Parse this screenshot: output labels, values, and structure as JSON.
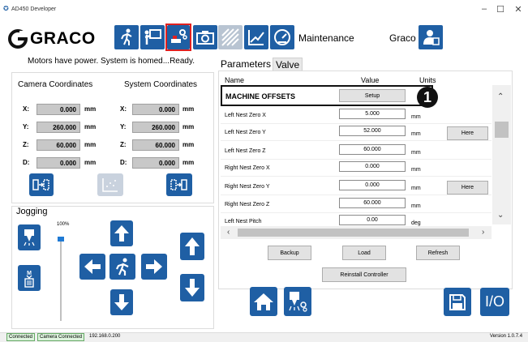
{
  "window": {
    "title": "AD450 Developer",
    "minimize": "–",
    "maximize": "☐",
    "close": "✕"
  },
  "brand": {
    "logo_text": "GRACO"
  },
  "toolbar": {
    "mode_label": "Maintenance",
    "user_name": "Graco"
  },
  "status_line": "Motors have power. System is homed...Ready.",
  "coordinates": {
    "camera_title": "Camera Coordinates",
    "system_title": "System Coordinates",
    "unit": "mm",
    "rows": [
      {
        "axis": "X:",
        "camera": "0.000",
        "system": "0.000"
      },
      {
        "axis": "Y:",
        "camera": "260.000",
        "system": "260.000"
      },
      {
        "axis": "Z:",
        "camera": "60.000",
        "system": "60.000"
      },
      {
        "axis": "D:",
        "camera": "0.000",
        "system": "0.000"
      }
    ]
  },
  "jogging": {
    "title": "Jogging",
    "speed_label": "100%",
    "speed_fraction": 1.0
  },
  "tabs": {
    "parameters": "Parameters",
    "valve": "Valve"
  },
  "table": {
    "headers": {
      "name": "Name",
      "value": "Value",
      "units": "Units"
    },
    "section_title": "MACHINE OFFSETS",
    "setup_button": "Setup",
    "callout": "1",
    "rows": [
      {
        "name": "Left Nest Zero X",
        "value": "5.000",
        "unit": "mm",
        "action": ""
      },
      {
        "name": "Left Nest Zero Y",
        "value": "52.000",
        "unit": "mm",
        "action": "Here"
      },
      {
        "name": "Left Nest Zero Z",
        "value": "60.000",
        "unit": "mm",
        "action": ""
      },
      {
        "name": "Right Nest Zero X",
        "value": "0.000",
        "unit": "mm",
        "action": ""
      },
      {
        "name": "Right Nest Zero Y",
        "value": "0.000",
        "unit": "mm",
        "action": "Here"
      },
      {
        "name": "Right Nest Zero Z",
        "value": "60.000",
        "unit": "mm",
        "action": ""
      },
      {
        "name": "Left Nest Pitch",
        "value": "0.00",
        "unit": "deg",
        "action": ""
      }
    ]
  },
  "actions": {
    "backup": "Backup",
    "load": "Load",
    "refresh": "Refresh",
    "reinstall": "Reinstall Controller"
  },
  "bottom_buttons": {
    "io_label": "I/O"
  },
  "statusbar": {
    "connected": "Connected",
    "camera": "Camera Connected",
    "ip": "192.168.0.200",
    "version": "Version 1.0.7.4"
  },
  "colors": {
    "accent_blue": "#1f5fa4",
    "selected_red": "#e0201f",
    "panel_gray": "#c8c8c8"
  }
}
